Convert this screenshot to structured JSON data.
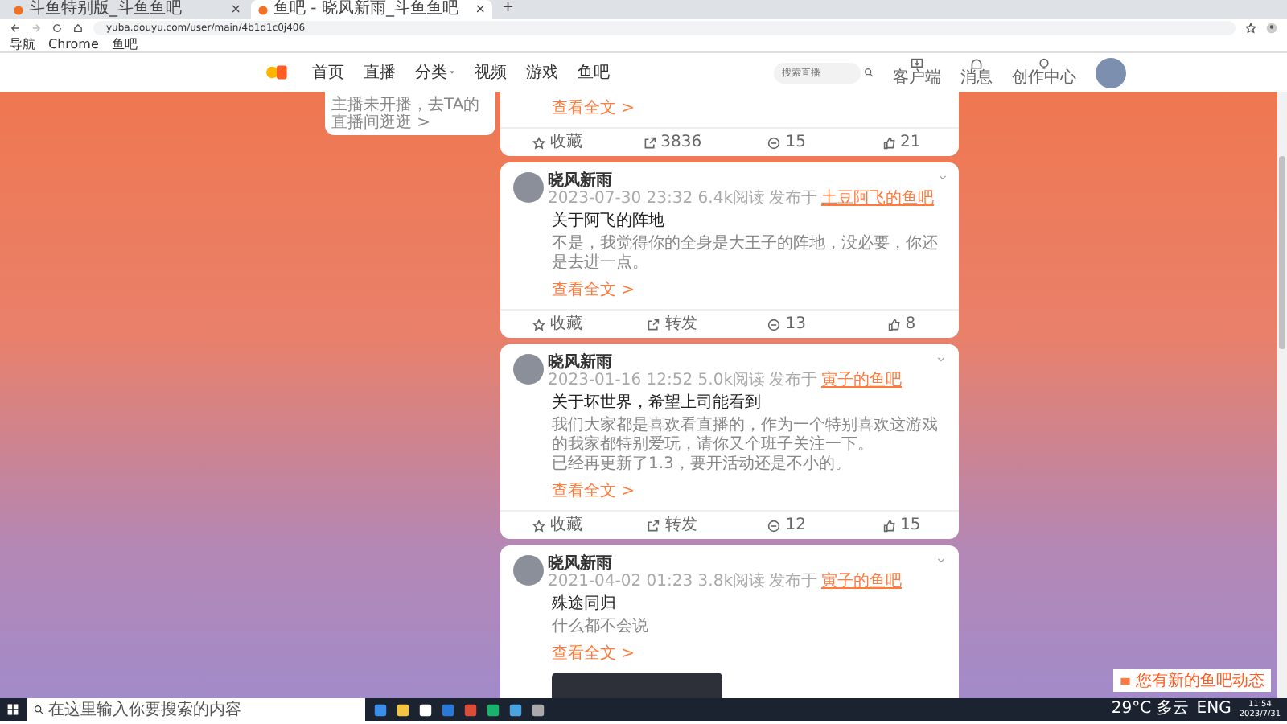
{
  "browser": {
    "tabs": [
      {
        "title": "斗鱼特别版_斗鱼鱼吧",
        "selected": false,
        "close": "×"
      },
      {
        "title": "鱼吧 - 晓风新雨_斗鱼鱼吧",
        "selected": true,
        "close": "×"
      }
    ],
    "new_tab": "+",
    "url": "yuba.douyu.com/user/main/4b1d1c0j406",
    "bookmarks": [
      "导航",
      "Chrome",
      "鱼吧"
    ]
  },
  "site": {
    "nav": [
      {
        "label": "首页",
        "dropdown": false
      },
      {
        "label": "直播",
        "dropdown": false
      },
      {
        "label": "分类",
        "dropdown": true
      },
      {
        "label": "视频",
        "dropdown": false
      },
      {
        "label": "游戏",
        "dropdown": false
      },
      {
        "label": "鱼吧",
        "dropdown": false
      }
    ],
    "search": {
      "placeholder": "搜索直播"
    },
    "actions": [
      {
        "kind": "download",
        "label": "客户端"
      },
      {
        "kind": "message",
        "label": "消息"
      },
      {
        "kind": "create",
        "label": "创作中心"
      }
    ]
  },
  "sidebar_card": {
    "text": "主播未开播，去TA的直播间逛逛 >"
  },
  "posts": [
    {
      "kind": "tail",
      "read_more": "查看全文 >",
      "actions": [
        {
          "kind": "collect",
          "label": "收藏"
        },
        {
          "kind": "share",
          "label": "3836"
        },
        {
          "kind": "comment",
          "label": "15"
        },
        {
          "kind": "like",
          "label": "21"
        }
      ]
    },
    {
      "kind": "full",
      "author": "晓风新雨",
      "meta": "2023-07-30 23:32 6.4k阅读",
      "posted_in": "发布于",
      "forum": "土豆阿飞的鱼吧",
      "title": "关于阿飞的阵地",
      "body": [
        "不是，我觉得你的全身是大王子的阵地，没必要，你还是去进一点。"
      ],
      "read_more": "查看全文 >",
      "media": false,
      "actions": [
        {
          "kind": "collect",
          "label": "收藏"
        },
        {
          "kind": "share",
          "label": "转发"
        },
        {
          "kind": "comment",
          "label": "13"
        },
        {
          "kind": "like",
          "label": "8"
        }
      ]
    },
    {
      "kind": "full",
      "author": "晓风新雨",
      "meta": "2023-01-16 12:52 5.0k阅读",
      "posted_in": "发布于",
      "forum": "寅子的鱼吧",
      "title": "关于坏世界，希望上司能看到",
      "body": [
        "我们大家都是喜欢看直播的，作为一个特别喜欢这游戏的我家都特别爱玩，请你又个班子关注一下。",
        "已经再更新了1.3，要开活动还是不小的。"
      ],
      "read_more": "查看全文 >",
      "media": false,
      "actions": [
        {
          "kind": "collect",
          "label": "收藏"
        },
        {
          "kind": "share",
          "label": "转发"
        },
        {
          "kind": "comment",
          "label": "12"
        },
        {
          "kind": "like",
          "label": "15"
        }
      ]
    },
    {
      "kind": "full",
      "author": "晓风新雨",
      "meta": "2021-04-02 01:23 3.8k阅读",
      "posted_in": "发布于",
      "forum": "寅子的鱼吧",
      "title": "殊途同归",
      "body": [
        "什么都不会说"
      ],
      "read_more": "查看全文 >",
      "media": true
    }
  ],
  "toast": {
    "text": "您有新的鱼吧动态"
  },
  "taskbar": {
    "search_placeholder": "在这里输入你要搜索的内容",
    "weather": "29°C 多云",
    "language": "ENG",
    "time": "11:54",
    "date": "2023/7/31"
  }
}
